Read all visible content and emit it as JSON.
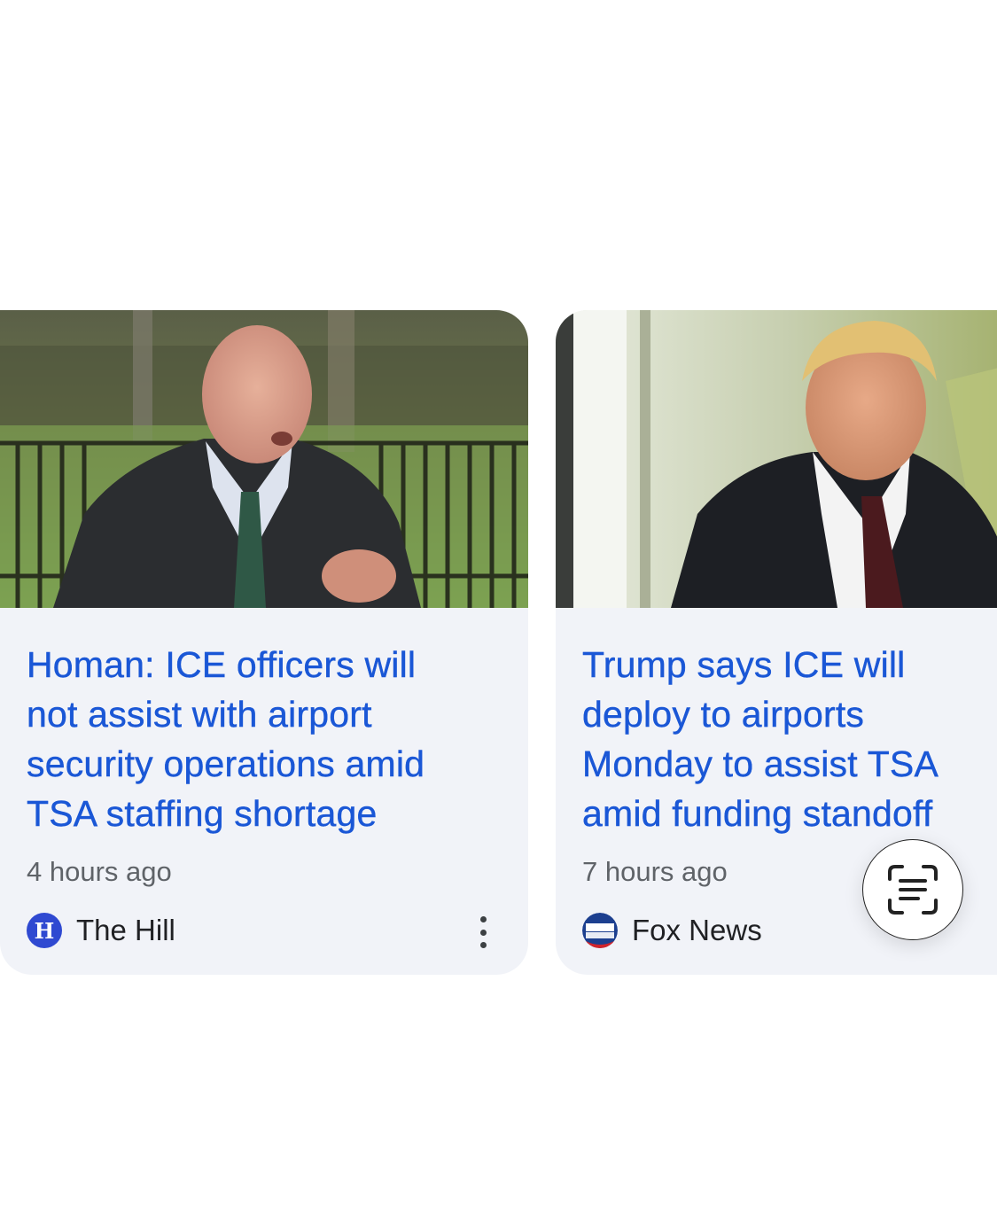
{
  "cards": [
    {
      "headline": "Homan: ICE officers will\nnot assist with airport\nsecurity operations amid\nTSA staffing shortage",
      "time": "4 hours ago",
      "source": "The Hill",
      "source_logo_letter": "H",
      "image_icon": "photo-man-speaking-outdoors"
    },
    {
      "headline": "Trump says ICE will\ndeploy to airports\nMonday to assist TSA\namid funding standoff",
      "time": "7 hours ago",
      "source": "Fox News",
      "image_icon": "photo-man-in-suit"
    }
  ],
  "overlay": {
    "lens_button_icon": "text-scan-icon"
  },
  "colors": {
    "headline": "#1a57d6",
    "card_bg": "#f1f3f8",
    "meta_text": "#5f6368"
  }
}
